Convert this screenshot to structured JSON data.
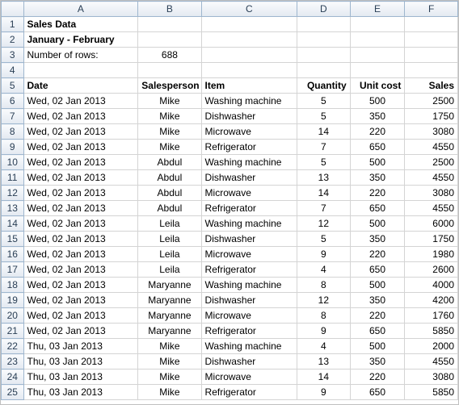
{
  "columns": [
    "A",
    "B",
    "C",
    "D",
    "E",
    "F"
  ],
  "header": {
    "title": "Sales Data",
    "subtitle": "January - February",
    "rowCountLabel": "Number of rows:",
    "rowCountValue": "688"
  },
  "tableHeaders": {
    "date": "Date",
    "salesperson": "Salesperson",
    "item": "Item",
    "quantity": "Quantity",
    "unitCost": "Unit cost",
    "sales": "Sales"
  },
  "rows": [
    {
      "n": "6",
      "date": "Wed, 02 Jan 2013",
      "sp": "Mike",
      "item": "Washing machine",
      "qty": "5",
      "uc": "500",
      "sales": "2500"
    },
    {
      "n": "7",
      "date": "Wed, 02 Jan 2013",
      "sp": "Mike",
      "item": "Dishwasher",
      "qty": "5",
      "uc": "350",
      "sales": "1750"
    },
    {
      "n": "8",
      "date": "Wed, 02 Jan 2013",
      "sp": "Mike",
      "item": "Microwave",
      "qty": "14",
      "uc": "220",
      "sales": "3080"
    },
    {
      "n": "9",
      "date": "Wed, 02 Jan 2013",
      "sp": "Mike",
      "item": "Refrigerator",
      "qty": "7",
      "uc": "650",
      "sales": "4550"
    },
    {
      "n": "10",
      "date": "Wed, 02 Jan 2013",
      "sp": "Abdul",
      "item": "Washing machine",
      "qty": "5",
      "uc": "500",
      "sales": "2500"
    },
    {
      "n": "11",
      "date": "Wed, 02 Jan 2013",
      "sp": "Abdul",
      "item": "Dishwasher",
      "qty": "13",
      "uc": "350",
      "sales": "4550"
    },
    {
      "n": "12",
      "date": "Wed, 02 Jan 2013",
      "sp": "Abdul",
      "item": "Microwave",
      "qty": "14",
      "uc": "220",
      "sales": "3080"
    },
    {
      "n": "13",
      "date": "Wed, 02 Jan 2013",
      "sp": "Abdul",
      "item": "Refrigerator",
      "qty": "7",
      "uc": "650",
      "sales": "4550"
    },
    {
      "n": "14",
      "date": "Wed, 02 Jan 2013",
      "sp": "Leila",
      "item": "Washing machine",
      "qty": "12",
      "uc": "500",
      "sales": "6000"
    },
    {
      "n": "15",
      "date": "Wed, 02 Jan 2013",
      "sp": "Leila",
      "item": "Dishwasher",
      "qty": "5",
      "uc": "350",
      "sales": "1750"
    },
    {
      "n": "16",
      "date": "Wed, 02 Jan 2013",
      "sp": "Leila",
      "item": "Microwave",
      "qty": "9",
      "uc": "220",
      "sales": "1980"
    },
    {
      "n": "17",
      "date": "Wed, 02 Jan 2013",
      "sp": "Leila",
      "item": "Refrigerator",
      "qty": "4",
      "uc": "650",
      "sales": "2600"
    },
    {
      "n": "18",
      "date": "Wed, 02 Jan 2013",
      "sp": "Maryanne",
      "item": "Washing machine",
      "qty": "8",
      "uc": "500",
      "sales": "4000"
    },
    {
      "n": "19",
      "date": "Wed, 02 Jan 2013",
      "sp": "Maryanne",
      "item": "Dishwasher",
      "qty": "12",
      "uc": "350",
      "sales": "4200"
    },
    {
      "n": "20",
      "date": "Wed, 02 Jan 2013",
      "sp": "Maryanne",
      "item": "Microwave",
      "qty": "8",
      "uc": "220",
      "sales": "1760"
    },
    {
      "n": "21",
      "date": "Wed, 02 Jan 2013",
      "sp": "Maryanne",
      "item": "Refrigerator",
      "qty": "9",
      "uc": "650",
      "sales": "5850"
    },
    {
      "n": "22",
      "date": "Thu, 03 Jan 2013",
      "sp": "Mike",
      "item": "Washing machine",
      "qty": "4",
      "uc": "500",
      "sales": "2000"
    },
    {
      "n": "23",
      "date": "Thu, 03 Jan 2013",
      "sp": "Mike",
      "item": "Dishwasher",
      "qty": "13",
      "uc": "350",
      "sales": "4550"
    },
    {
      "n": "24",
      "date": "Thu, 03 Jan 2013",
      "sp": "Mike",
      "item": "Microwave",
      "qty": "14",
      "uc": "220",
      "sales": "3080"
    },
    {
      "n": "25",
      "date": "Thu, 03 Jan 2013",
      "sp": "Mike",
      "item": "Refrigerator",
      "qty": "9",
      "uc": "650",
      "sales": "5850"
    }
  ],
  "fixedRowNumbers": [
    "1",
    "2",
    "3",
    "4",
    "5"
  ]
}
